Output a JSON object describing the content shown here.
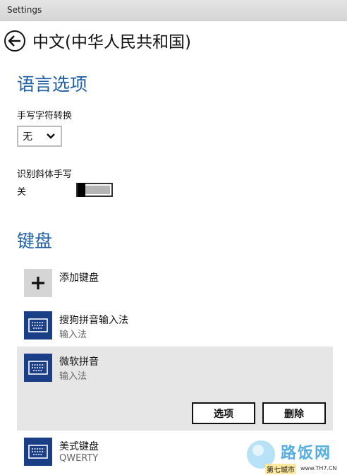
{
  "window": {
    "title": "Settings"
  },
  "header": {
    "title": "中文(中华人民共和国)"
  },
  "language_options": {
    "section_title": "语言选项",
    "handwriting_label": "手写字符转换",
    "handwriting_value": "无",
    "cursive_label": "识别斜体手写",
    "cursive_state": "关"
  },
  "keyboard": {
    "section_title": "键盘",
    "add_label": "添加键盘",
    "items": [
      {
        "name": "搜狗拼音输入法",
        "sub": "输入法"
      },
      {
        "name": "微软拼音",
        "sub": "输入法"
      },
      {
        "name": "美式键盘",
        "sub": "QWERTY"
      }
    ],
    "options_button": "选项",
    "delete_button": "删除"
  },
  "watermark": {
    "logo_text": "路饭网",
    "site_name": "第七城市",
    "url": "www.TH7.CN"
  },
  "colors": {
    "accent": "#1f5fa6",
    "tile": "#1b3f86",
    "selected": "#e6e6e6"
  }
}
